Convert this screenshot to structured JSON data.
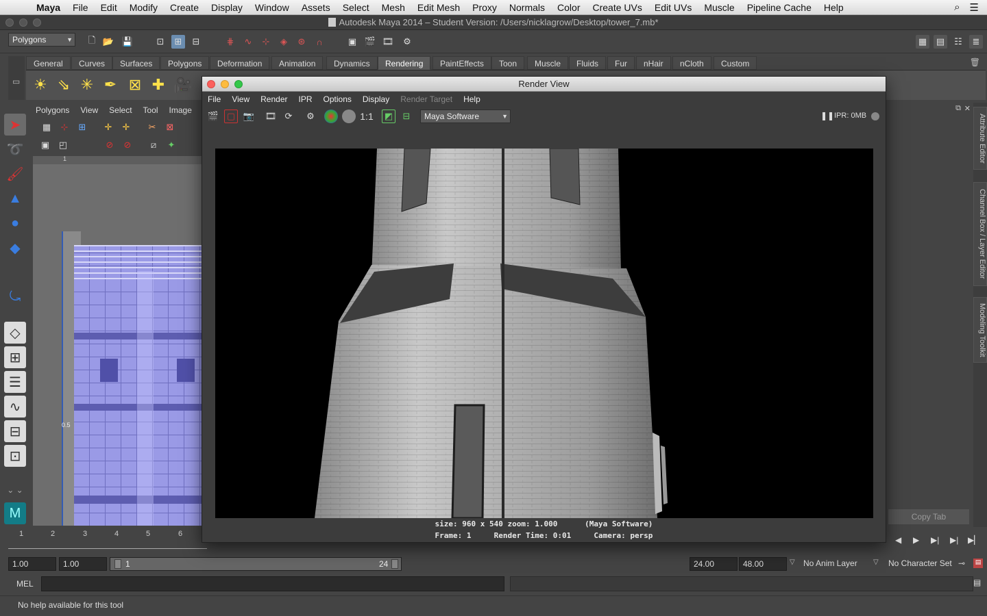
{
  "menubar": {
    "app": "Maya",
    "items": [
      "File",
      "Edit",
      "Modify",
      "Create",
      "Display",
      "Window",
      "Assets",
      "Select",
      "Mesh",
      "Edit Mesh",
      "Proxy",
      "Normals",
      "Color",
      "Create UVs",
      "Edit UVs",
      "Muscle",
      "Pipeline Cache",
      "Help"
    ]
  },
  "window": {
    "title": "Autodesk Maya 2014 – Student Version: /Users/nicklagrow/Desktop/tower_7.mb*"
  },
  "statusline": {
    "menu_set": "Polygons"
  },
  "shelf": {
    "tabs": [
      "General",
      "Curves",
      "Surfaces",
      "Polygons",
      "Deformation",
      "Animation",
      "Dynamics",
      "Rendering",
      "PaintEffects",
      "Toon",
      "Muscle",
      "Fluids",
      "Fur",
      "nHair",
      "nCloth",
      "Custom"
    ],
    "active_tab": "Rendering"
  },
  "uv_editor": {
    "menu": [
      "Polygons",
      "View",
      "Select",
      "Tool",
      "Image"
    ],
    "ruler_top": "1",
    "ruler_labels": [
      "0.5"
    ]
  },
  "render_view": {
    "title": "Render View",
    "menu": [
      "File",
      "View",
      "Render",
      "IPR",
      "Options",
      "Display",
      "Render Target",
      "Help"
    ],
    "renderer": "Maya Software",
    "ratio_label": "1:1",
    "ipr_label": "IPR: 0MB",
    "info_line1": "size: 960 x 540 zoom: 1.000      (Maya Software)",
    "info_line2": "Frame: 1     Render Time: 0:01     Camera: persp"
  },
  "side_tabs": [
    "Attribute Editor",
    "Channel Box / Layer Editor",
    "Modeling Toolkit"
  ],
  "right_panel": {
    "copy_tab": "Copy Tab"
  },
  "timeline": {
    "ticks": [
      "1",
      "2",
      "3",
      "4",
      "5",
      "6"
    ]
  },
  "range": {
    "start": "1.00",
    "playback_start": "1.00",
    "slider_start": "1",
    "slider_end": "24",
    "playback_end": "24.00",
    "end": "48.00",
    "anim_layer": "No Anim Layer",
    "character_set": "No Character Set"
  },
  "command_line": {
    "mode": "MEL"
  },
  "help_line": {
    "text": "No help available for this tool"
  },
  "colors": {
    "accent_uv": "#9a9ae6",
    "render_bg": "#000000"
  }
}
